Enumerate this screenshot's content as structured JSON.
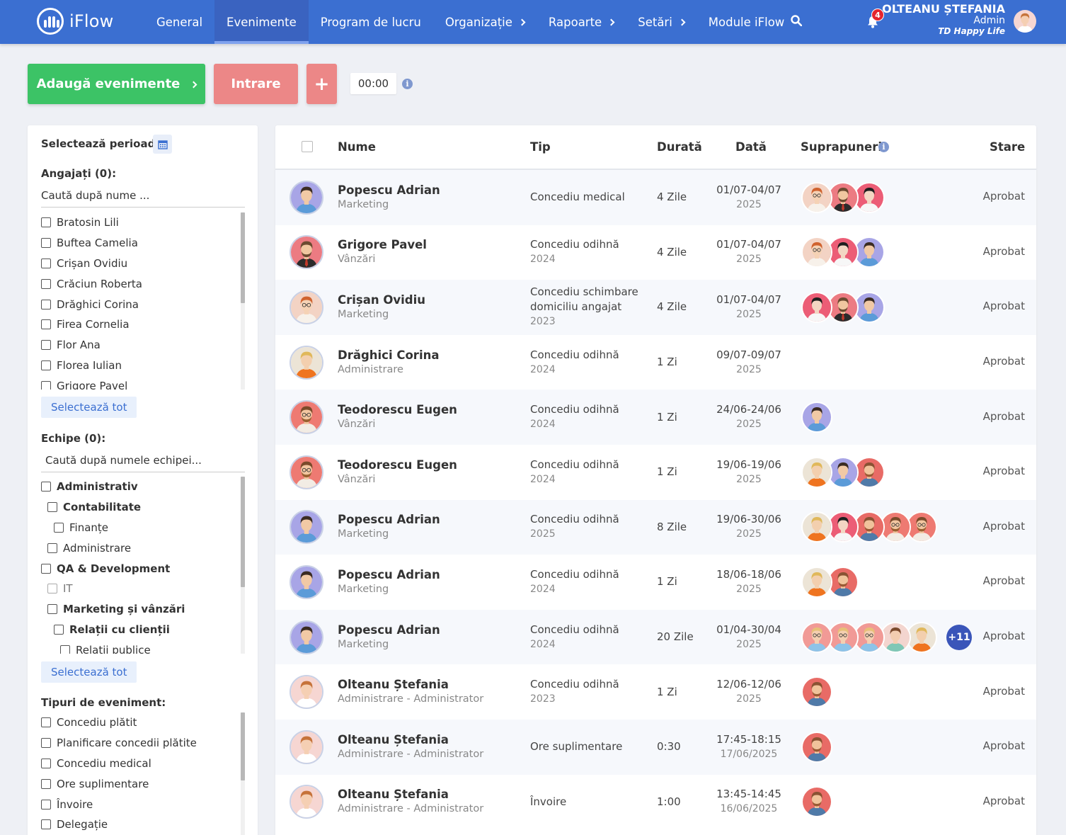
{
  "app": {
    "logo_text": "iFlow",
    "brand_color": "#3b6fd1",
    "nav": [
      {
        "label": "General",
        "has_chevron": false,
        "active": false
      },
      {
        "label": "Evenimente",
        "has_chevron": false,
        "active": true
      },
      {
        "label": "Program de lucru",
        "has_chevron": false,
        "active": false
      },
      {
        "label": "Organizație",
        "has_chevron": true,
        "active": false
      },
      {
        "label": "Rapoarte",
        "has_chevron": true,
        "active": false
      },
      {
        "label": "Setări",
        "has_chevron": true,
        "active": false
      },
      {
        "label": "Module iFlow",
        "has_chevron": false,
        "active": false
      }
    ],
    "notifications_count": "4",
    "user": {
      "name": "OLTEANU ȘTEFANIA",
      "role": "Admin",
      "company": "TD Happy Life"
    }
  },
  "actions": {
    "add_events": "Adaugă evenimente",
    "entry": "Intrare",
    "plus": "+",
    "timer": "00:00",
    "add_color": "#3cc366",
    "entry_color": "#ec8787"
  },
  "filters": {
    "period_label": "Selectează perioada:",
    "employees_label": "Angajați (0):",
    "employees_search_placeholder": "Caută după nume ...",
    "employees": [
      "Bratosin Lili",
      "Buftea Camelia",
      "Crișan Ovidiu",
      "Crăciun Roberta",
      "Drăghici Corina",
      "Firea Cornelia",
      "Flor Ana",
      "Florea Iulian",
      "Grigore Pavel"
    ],
    "select_all": "Selectează tot",
    "teams_label": "Echipe (0):",
    "teams_search_placeholder": "Caută după numele echipei...",
    "teams": [
      {
        "label": "Administrativ",
        "level": 0,
        "bold": true,
        "faded": false
      },
      {
        "label": "Contabilitate",
        "level": 1,
        "bold": true,
        "faded": false
      },
      {
        "label": "Finanțe",
        "level": 2,
        "bold": false,
        "faded": false
      },
      {
        "label": "Administrare",
        "level": 1,
        "bold": false,
        "faded": false
      },
      {
        "label": "QA & Development",
        "level": 0,
        "bold": true,
        "faded": false
      },
      {
        "label": "IT",
        "level": 1,
        "bold": false,
        "faded": true
      },
      {
        "label": "Marketing și vânzări",
        "level": 1,
        "bold": true,
        "faded": false
      },
      {
        "label": "Relații cu clienții",
        "level": 2,
        "bold": true,
        "faded": false
      },
      {
        "label": "Relații publice",
        "level": 3,
        "bold": false,
        "faded": false
      }
    ],
    "event_types_label": "Tipuri de eveniment:",
    "event_types": [
      "Concediu plătit",
      "Planificare concedii plătite",
      "Concediu medical",
      "Ore suplimentare",
      "Învoire",
      "Delegație"
    ]
  },
  "table": {
    "columns": {
      "name": "Nume",
      "type": "Tip",
      "duration": "Durată",
      "date": "Dată",
      "overlaps": "Suprapuneri",
      "status": "Stare"
    },
    "rows": [
      {
        "name": "Popescu Adrian",
        "dept": "Marketing",
        "avatar": "p-blue",
        "type": [
          "Concediu medical"
        ],
        "type_sub": "",
        "duration": "4 Zile",
        "date1": "01/07-04/07",
        "date2": "2025",
        "overlaps": [
          "p-ginger",
          "p-suit",
          "p-pink"
        ],
        "more": "",
        "status": "Aprobat"
      },
      {
        "name": "Grigore Pavel",
        "dept": "Vânzări",
        "avatar": "p-suit",
        "type": [
          "Concediu odihnă"
        ],
        "type_sub": "2024",
        "duration": "4 Zile",
        "date1": "01/07-04/07",
        "date2": "2025",
        "overlaps": [
          "p-ginger",
          "p-pink",
          "p-blue"
        ],
        "more": "",
        "status": "Aprobat"
      },
      {
        "name": "Crișan Ovidiu",
        "dept": "Marketing",
        "avatar": "p-ginger",
        "type": [
          "Concediu schimbare",
          "domiciliu angajat"
        ],
        "type_sub": "2023",
        "duration": "4 Zile",
        "date1": "01/07-04/07",
        "date2": "2025",
        "overlaps": [
          "p-pink",
          "p-suit",
          "p-blue"
        ],
        "more": "",
        "status": "Aprobat"
      },
      {
        "name": "Drăghici Corina",
        "dept": "Administrare",
        "avatar": "p-blonde",
        "type": [
          "Concediu odihnă"
        ],
        "type_sub": "2024",
        "duration": "1 Zi",
        "date1": "09/07-09/07",
        "date2": "2025",
        "overlaps": [],
        "more": "",
        "status": "Aprobat"
      },
      {
        "name": "Teodorescu Eugen",
        "dept": "Vânzări",
        "avatar": "p-stripe",
        "type": [
          "Concediu odihnă"
        ],
        "type_sub": "2024",
        "duration": "1 Zi",
        "date1": "24/06-24/06",
        "date2": "2025",
        "overlaps": [
          "p-blue"
        ],
        "more": "",
        "status": "Aprobat"
      },
      {
        "name": "Teodorescu Eugen",
        "dept": "Vânzări",
        "avatar": "p-stripe",
        "type": [
          "Concediu odihnă"
        ],
        "type_sub": "2024",
        "duration": "1 Zi",
        "date1": "19/06-19/06",
        "date2": "2025",
        "overlaps": [
          "p-blonde",
          "p-blue",
          "p-beard"
        ],
        "more": "",
        "status": "Aprobat"
      },
      {
        "name": "Popescu Adrian",
        "dept": "Marketing",
        "avatar": "p-blue",
        "type": [
          "Concediu odihnă"
        ],
        "type_sub": "2025",
        "duration": "8 Zile",
        "date1": "19/06-30/06",
        "date2": "2025",
        "overlaps": [
          "p-blonde",
          "p-pink",
          "p-beard",
          "p-stripe",
          "p-stripe"
        ],
        "more": "",
        "status": "Aprobat"
      },
      {
        "name": "Popescu Adrian",
        "dept": "Marketing",
        "avatar": "p-blue",
        "type": [
          "Concediu odihnă"
        ],
        "type_sub": "2024",
        "duration": "1 Zi",
        "date1": "18/06-18/06",
        "date2": "2025",
        "overlaps": [
          "p-blonde",
          "p-beard"
        ],
        "more": "",
        "status": "Aprobat"
      },
      {
        "name": "Popescu Adrian",
        "dept": "Marketing",
        "avatar": "p-blue",
        "type": [
          "Concediu odihnă"
        ],
        "type_sub": "2024",
        "duration": "20 Zile",
        "date1": "01/04-30/04",
        "date2": "2025",
        "overlaps": [
          "p-glasses",
          "p-glasses",
          "p-glasses",
          "p-woman",
          "p-blonde"
        ],
        "more": "+11",
        "status": "Aprobat"
      },
      {
        "name": "Olteanu Ștefania",
        "dept": "Administrare - Administrator",
        "avatar": "p-stef",
        "type": [
          "Concediu odihnă"
        ],
        "type_sub": "2023",
        "duration": "1 Zi",
        "date1": "12/06-12/06",
        "date2": "2025",
        "overlaps": [
          "p-beard"
        ],
        "more": "",
        "status": "Aprobat"
      },
      {
        "name": "Olteanu Ștefania",
        "dept": "Administrare - Administrator",
        "avatar": "p-stef",
        "type": [
          "Ore suplimentare"
        ],
        "type_sub": "",
        "duration": "0:30",
        "date1": "17:45-18:15",
        "date2": "17/06/2025",
        "overlaps": [
          "p-beard"
        ],
        "more": "",
        "status": "Aprobat"
      },
      {
        "name": "Olteanu Ștefania",
        "dept": "Administrare - Administrator",
        "avatar": "p-stef",
        "type": [
          "Învoire"
        ],
        "type_sub": "",
        "duration": "1:00",
        "date1": "13:45-14:45",
        "date2": "16/06/2025",
        "overlaps": [
          "p-beard"
        ],
        "more": "",
        "status": "Aprobat"
      }
    ]
  }
}
